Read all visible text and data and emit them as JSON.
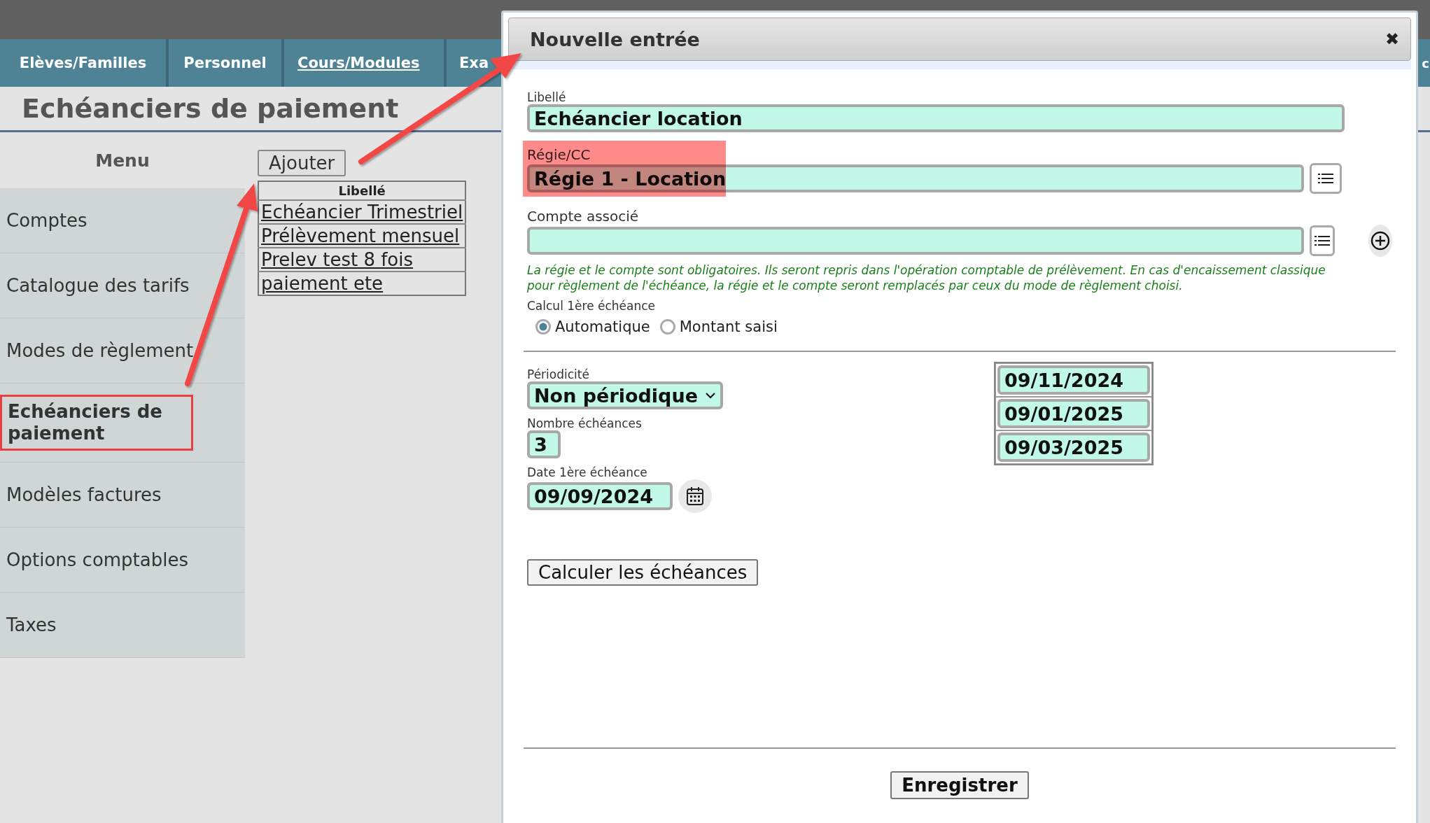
{
  "top_nav": {
    "tabs": [
      {
        "label": "Elèves/Familles",
        "selected": false
      },
      {
        "label": "Personnel",
        "selected": false
      },
      {
        "label": "Cours/Modules",
        "selected": true
      },
      {
        "label": "Exa",
        "selected": false
      }
    ],
    "cut_tab": "c"
  },
  "page_title": "Echéanciers de paiement",
  "menu": {
    "title": "Menu",
    "items": [
      {
        "label": "Comptes",
        "selected": false
      },
      {
        "label": "Catalogue des tarifs",
        "selected": false
      },
      {
        "label": "Modes de règlement",
        "selected": false
      },
      {
        "label": "Echéanciers de paiement",
        "selected": true
      },
      {
        "label": "Modèles factures",
        "selected": false
      },
      {
        "label": "Options comptables",
        "selected": false
      },
      {
        "label": "Taxes",
        "selected": false
      }
    ]
  },
  "add_button": "Ajouter",
  "list": {
    "column": "Libellé",
    "rows": [
      "Echéancier Trimestriel",
      "Prélèvement mensuel",
      "Prelev test 8 fois",
      "paiement ete"
    ]
  },
  "dialog": {
    "title": "Nouvelle entrée",
    "close": "✖",
    "libelle": {
      "label": "Libellé",
      "value": "Echéancier location"
    },
    "regie": {
      "label": "Régie/CC",
      "value": "Régie 1 - Location",
      "highlighted": true
    },
    "compte": {
      "label": "Compte associé"
    },
    "note": "La régie et le compte sont obligatoires. Ils seront repris dans l'opération comptable de prélèvement. En cas d'encaissement classique pour règlement de l'échéance, la régie et le compte seront remplacés par ceux du mode de règlement choisi.",
    "calcul": {
      "label": "Calcul 1ère échéance",
      "options": [
        {
          "label": "Automatique",
          "selected": true
        },
        {
          "label": "Montant saisi",
          "selected": false
        }
      ]
    },
    "periodicite": {
      "label": "Périodicité",
      "value": "Non périodique"
    },
    "nombre": {
      "label": "Nombre échéances",
      "value": "3"
    },
    "date": {
      "label": "Date 1ère échéance",
      "value": "09/09/2024"
    },
    "dates": [
      "09/11/2024",
      "09/01/2025",
      "09/03/2025"
    ],
    "calculate_button": "Calculer les échéances",
    "save_button": "Enregistrer"
  }
}
